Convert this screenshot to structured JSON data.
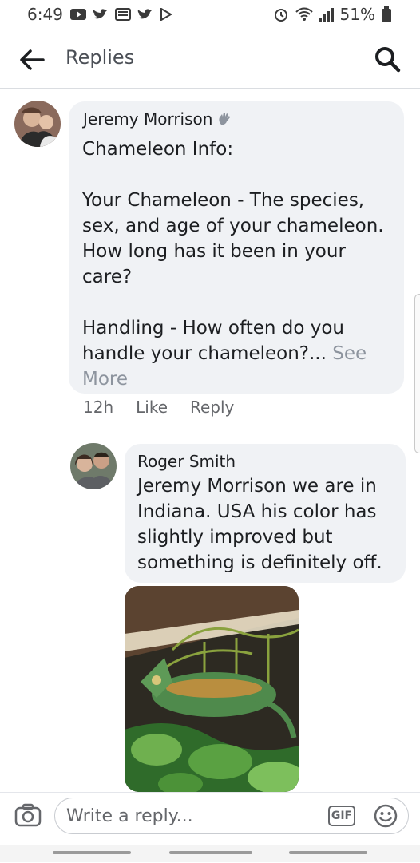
{
  "status_bar": {
    "time": "6:49",
    "battery": "51%"
  },
  "header": {
    "title": "Replies"
  },
  "comments": [
    {
      "author": "Jeremy Morrison",
      "text": "Chameleon Info:\n\nYour Chameleon - The species, sex, and age of your chameleon. How long has it been in your care?\n\nHandling - How often do you handle your chameleon?...",
      "see_more": " See More",
      "time": "12h",
      "like_label": "Like",
      "reply_label": "Reply"
    },
    {
      "author": "Roger Smith",
      "text": "Jeremy Morrison we are in Indiana. USA his color has slightly improved but something is definitely off."
    }
  ],
  "composer": {
    "placeholder": "Write a reply...",
    "gif_label": "GIF"
  },
  "icons": {
    "back": "arrow-left-icon",
    "search": "search-icon",
    "camera": "camera-icon",
    "emoji": "emoji-icon",
    "wave": "waving-hand-icon"
  },
  "colors": {
    "bubble": "#f0f2f5",
    "meta": "#65676b",
    "see_more": "#8d949e"
  }
}
